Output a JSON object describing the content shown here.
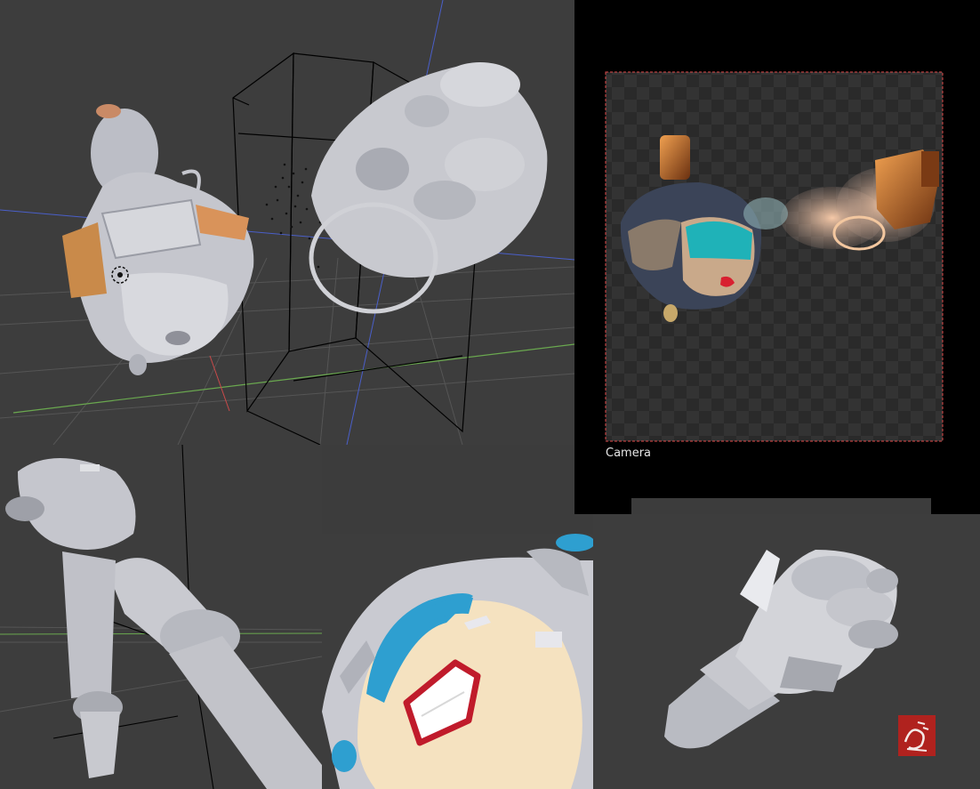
{
  "render_view": {
    "camera_label": "Camera"
  },
  "colors": {
    "viewport_bg": "#3d3d3d",
    "render_bg": "#000000",
    "grid_line": "#555555",
    "axis_x": "#c94a4a",
    "axis_y": "#6aa84f",
    "axis_z": "#4a5fc9",
    "camera_frame": "#e04a4a",
    "model_grey": "#c8c9cf",
    "skin": "#f4dfba",
    "hair": "#2e9fd0",
    "mouth": "#c01b2b",
    "copper": "#d4803a",
    "watermark": "#b0221e"
  },
  "icons": [
    "model-cursor-icon",
    "watermark-logo"
  ]
}
